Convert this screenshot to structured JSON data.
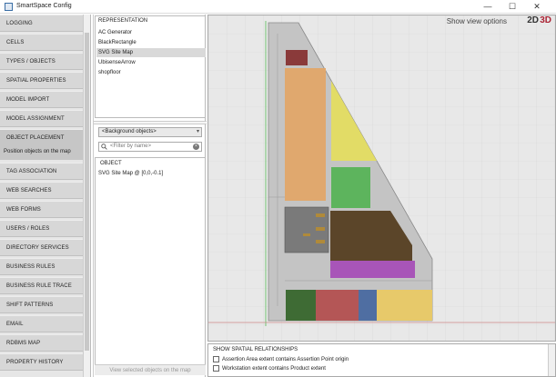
{
  "window": {
    "title": "SmartSpace Config",
    "minimize": "—",
    "maximize": "☐",
    "close": "✕"
  },
  "sidebar": {
    "items": [
      {
        "label": "LOGGING"
      },
      {
        "label": "CELLS"
      },
      {
        "label": "TYPES / OBJECTS"
      },
      {
        "label": "SPATIAL PROPERTIES"
      },
      {
        "label": "MODEL IMPORT"
      },
      {
        "label": "MODEL ASSIGNMENT"
      },
      {
        "label": "OBJECT PLACEMENT"
      },
      {
        "label": "TAG ASSOCIATION"
      },
      {
        "label": "WEB SEARCHES"
      },
      {
        "label": "WEB FORMS"
      },
      {
        "label": "USERS / ROLES"
      },
      {
        "label": "DIRECTORY SERVICES"
      },
      {
        "label": "BUSINESS RULES"
      },
      {
        "label": "BUSINESS RULE TRACE"
      },
      {
        "label": "SHIFT PATTERNS"
      },
      {
        "label": "EMAIL"
      },
      {
        "label": "RDBMS MAP"
      },
      {
        "label": "PROPERTY HISTORY"
      }
    ],
    "active_index": 6,
    "active_description": "Position objects on the map"
  },
  "representation": {
    "header": "REPRESENTATION",
    "items": [
      "AC Generator",
      "BlackRectangle",
      "SVG Site Map",
      "UbisenseArrow",
      "shopfloor"
    ],
    "selected_index": 2
  },
  "objects": {
    "dropdown_value": "<Background objects>",
    "filter_placeholder": "<Filter by name>",
    "header": "OBJECT",
    "items": [
      "SVG Site Map @ [0,0,-0.1]"
    ],
    "view_button": "View selected objects on the map"
  },
  "map": {
    "show_view_options": "Show view options",
    "mode_2d": "2D",
    "mode_3d": "3D",
    "colors": {
      "background": "#e8e8e8",
      "grid": "#d6d6d6",
      "site_fill": "#c4c4c4",
      "orange": "#e0a86e",
      "yellow": "#e2dc66",
      "green": "#5db45d",
      "brown": "#5b4529",
      "purple": "#a855b8",
      "red": "#8a3a3a",
      "dark_green": "#3e6b34",
      "salmon": "#b45656",
      "blue": "#4f6ea2",
      "gold": "#e7c96a"
    }
  },
  "relationships": {
    "header": "SHOW SPATIAL RELATIONSHIPS",
    "rows": [
      {
        "label": "Assertion Area extent contains Assertion Point origin",
        "checked": false
      },
      {
        "label": "Workstation extent contains Product extent",
        "checked": false
      }
    ]
  }
}
